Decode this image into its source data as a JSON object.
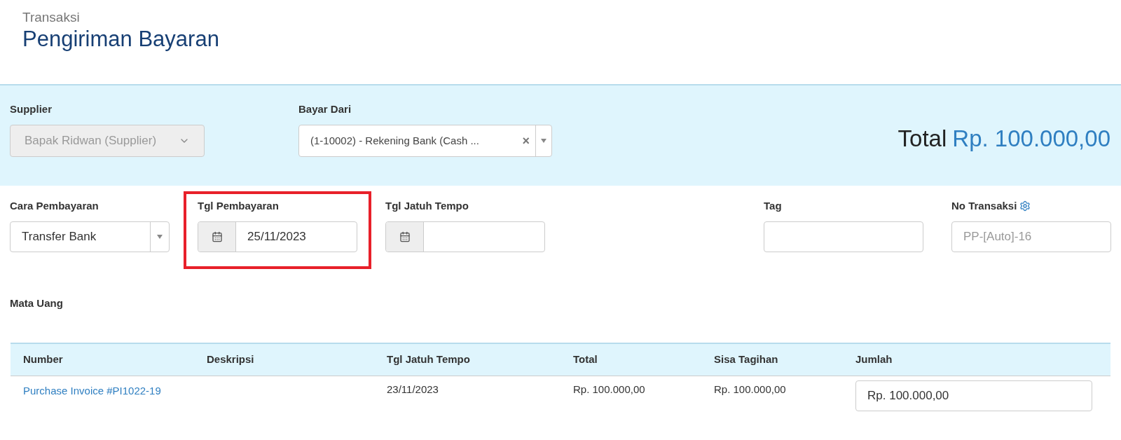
{
  "header": {
    "breadcrumb": "Transaksi",
    "title": "Pengiriman Bayaran"
  },
  "top_panel": {
    "supplier": {
      "label": "Supplier",
      "value": "Bapak Ridwan (Supplier)",
      "disabled": true
    },
    "bayar_dari": {
      "label": "Bayar Dari",
      "value": "(1-10002) - Rekening Bank (Cash ...",
      "clear": "×"
    },
    "total": {
      "label": "Total",
      "value": "Rp. 100.000,00"
    }
  },
  "fields": [
    {
      "kind": "select",
      "label": "Cara Pembayaran",
      "value": "Transfer Bank",
      "highlighted": false
    },
    {
      "kind": "date",
      "label": "Tgl Pembayaran",
      "value": "25/11/2023",
      "highlighted": true
    },
    {
      "kind": "date",
      "label": "Tgl Jatuh Tempo",
      "highlighted": false
    },
    {
      "kind": "spacer"
    },
    {
      "kind": "text",
      "label": "Tag",
      "highlighted": false
    },
    {
      "kind": "settings",
      "label": "No Transaksi",
      "placeholder": "PP-[Auto]-16",
      "highlighted": false
    }
  ],
  "currency_label": "Mata Uang",
  "table": {
    "columns": [
      "Number",
      "Deskripsi",
      "Tgl Jatuh Tempo",
      "Total",
      "Sisa Tagihan",
      "Jumlah"
    ],
    "rows": [
      {
        "number": "Purchase Invoice #PI1022-19",
        "due": "23/11/2023",
        "total": "Rp. 100.000,00",
        "sisa": "Rp. 100.000,00",
        "jumlah": "Rp. 100.000,00"
      }
    ]
  }
}
